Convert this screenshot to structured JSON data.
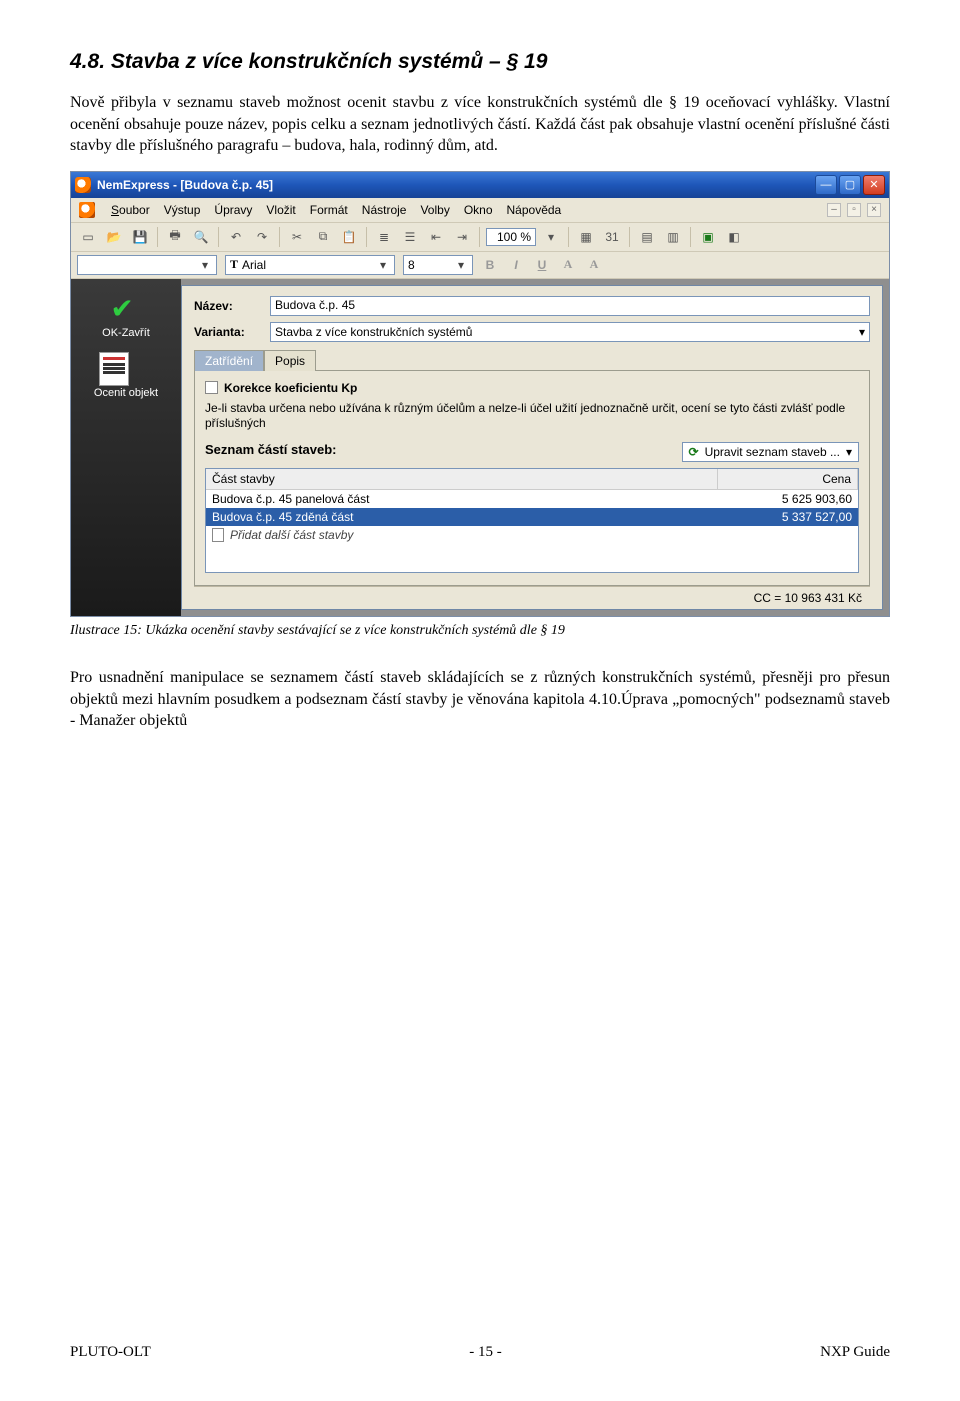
{
  "heading": "4.8. Stavba z více konstrukčních systémů – § 19",
  "para1": "Nově přibyla v seznamu staveb možnost ocenit stavbu z více konstrukčních systémů dle § 19 oceňovací vyhlášky. Vlastní ocenění obsahuje pouze název, popis celku a seznam jednotlivých částí. Každá část pak obsahuje vlastní ocenění příslušné části stavby dle příslušného paragrafu – budova, hala, rodinný dům, atd.",
  "app": {
    "title": "NemExpress - [Budova č.p. 45]",
    "menu": {
      "m0": "Soubor",
      "m1": "Výstup",
      "m2": "Úpravy",
      "m3": "Vložit",
      "m4": "Formát",
      "m5": "Nástroje",
      "m6": "Volby",
      "m7": "Okno",
      "m8": "Nápověda"
    },
    "zoom": "100 %",
    "font": "Arial",
    "fontsize": "8",
    "left": {
      "ok": "OK-Zavřít",
      "ocenit": "Ocenit objekt"
    },
    "form": {
      "nazev_label": "Název:",
      "nazev_value": "Budova č.p. 45",
      "varianta_label": "Varianta:",
      "varianta_value": "Stavba z více konstrukčních systémů"
    },
    "tabs": {
      "t0": "Zatřídění",
      "t1": "Popis"
    },
    "kp_label": "Korekce koeficientu Kp",
    "kp_help": "Je-li stavba určena nebo užívána k různým účelům a nelze-li účel užití jednoznačně určit, ocení se tyto části zvlášť podle příslušných",
    "list_label": "Seznam částí staveb:",
    "edit_label": "Upravit seznam staveb ...",
    "cols": {
      "c0": "Část stavby",
      "c1": "Cena"
    },
    "rows": [
      {
        "name": "Budova č.p. 45 panelová část",
        "price": "5 625 903,60"
      },
      {
        "name": "Budova č.p. 45 zděná část",
        "price": "5 337 527,00"
      }
    ],
    "addrow": "Přidat další část stavby",
    "cc": "CC = 10 963 431 Kč"
  },
  "caption": "Ilustrace 15: Ukázka ocenění stavby sestávající se z více konstrukčních systémů dle § 19",
  "para2": "Pro usnadnění manipulace se seznamem částí staveb skládajících se z různých konstrukčních systémů, přesněji pro přesun objektů mezi hlavním posudkem a podseznam částí stavby je věnována kapitola  4.10.Úprava „pomocných\" podseznamů staveb - Manažer objektů",
  "footer": {
    "left": "PLUTO-OLT",
    "center": "- 15 -",
    "right": "NXP Guide"
  }
}
